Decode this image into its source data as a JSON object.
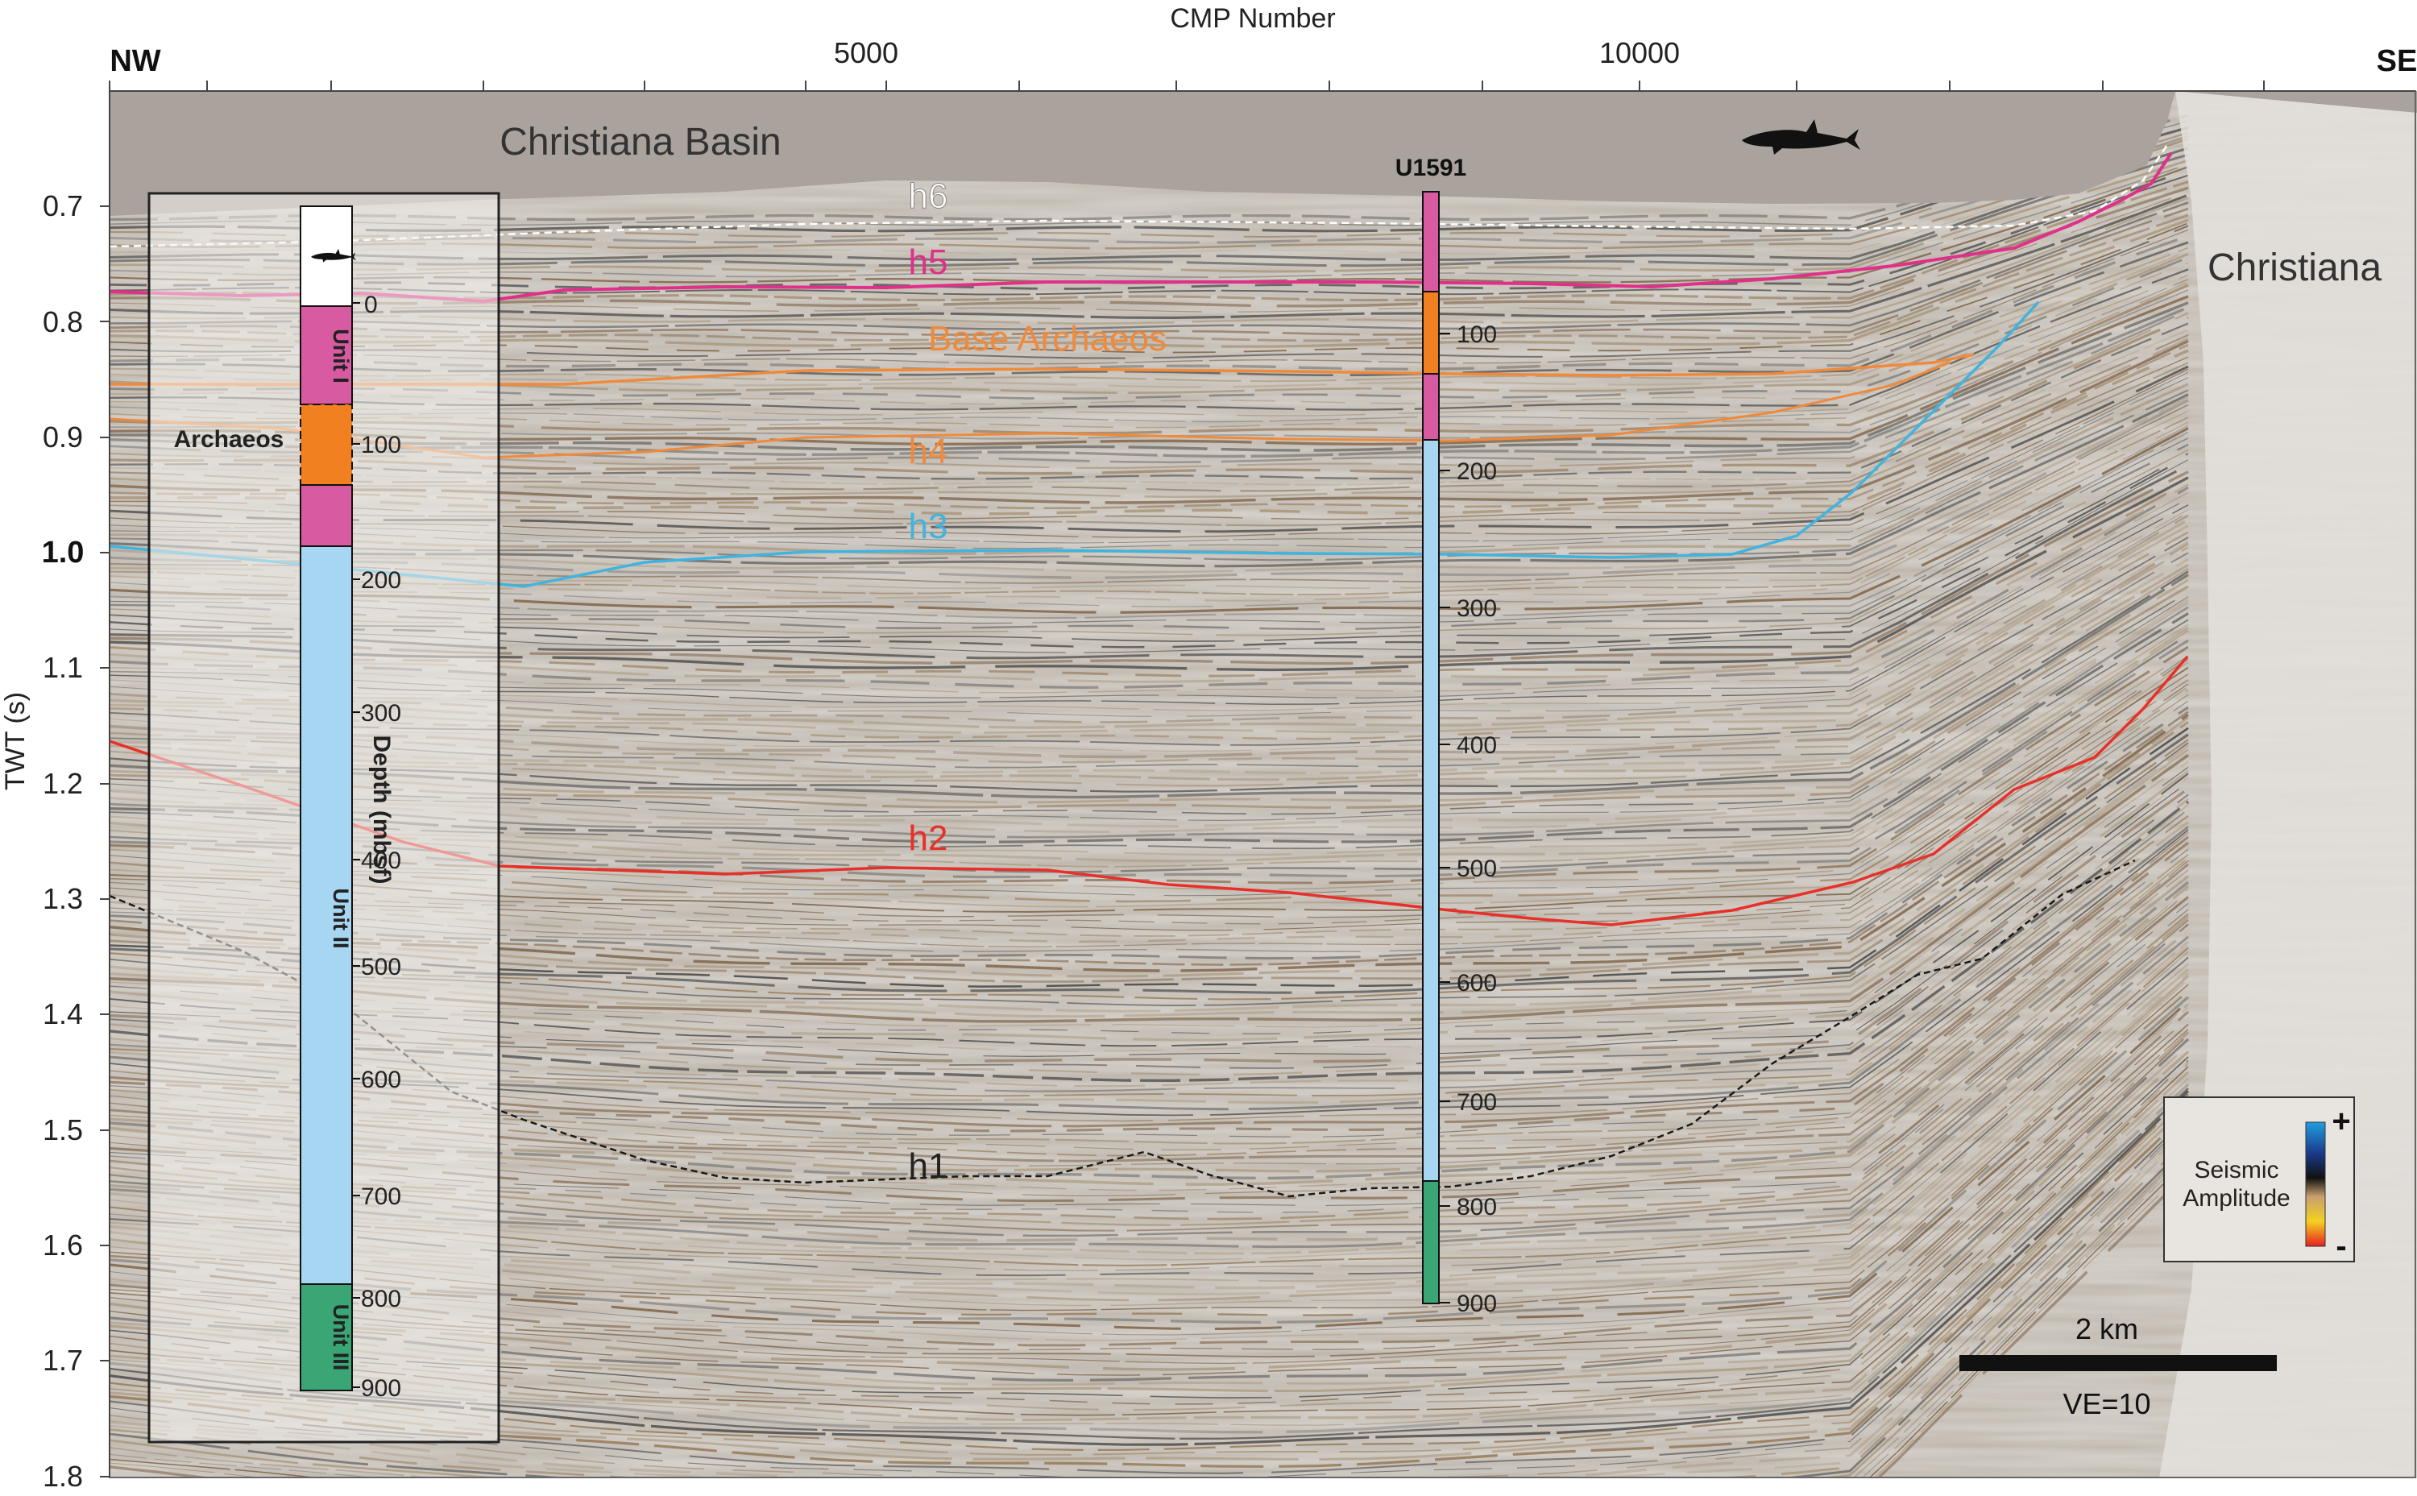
{
  "axes": {
    "top_title": "CMP Number",
    "top_ticks": [
      "5000",
      "10000"
    ],
    "left_title": "TWT (s)",
    "left_ticks": [
      "0.7",
      "0.8",
      "0.9",
      "1.0",
      "1.1",
      "1.2",
      "1.3",
      "1.4",
      "1.5",
      "1.6",
      "1.7",
      "1.8"
    ],
    "nw_label": "NW",
    "se_label": "SE"
  },
  "labels": {
    "basin": "Christiana Basin",
    "christiana": "Christiana",
    "well": "U1591",
    "archaeos": "Archaeos",
    "depth_title": "Depth (mbsf)"
  },
  "horizons": {
    "h6": "h6",
    "h5": "h5",
    "base_archaeos": "Base Archaeos",
    "h4": "h4",
    "h3": "h3",
    "h2": "h2",
    "h1": "h1"
  },
  "stratigraphic_column": {
    "units": [
      "Unit I",
      "Unit II",
      "Unit III"
    ],
    "depth_ticks": [
      "0",
      "100",
      "200",
      "300",
      "400",
      "500",
      "600",
      "700",
      "800",
      "900"
    ]
  },
  "well_column": {
    "depth_ticks": [
      "100",
      "200",
      "300",
      "400",
      "500",
      "600",
      "700",
      "800",
      "900"
    ]
  },
  "legend": {
    "title_line1": "Seismic",
    "title_line2": "Amplitude",
    "plus": "+",
    "minus": "-"
  },
  "scale_bar": {
    "label": "2 km",
    "ve": "VE=10"
  },
  "colors": {
    "unit_i": "#d85aa0",
    "archaeos": "#f08020",
    "unit_ii": "#a6d6f2",
    "unit_iii": "#3aa676",
    "h5": "#e0308a",
    "base_archaeos": "#f08a3a",
    "h3": "#40b4e0",
    "h2": "#e8302a",
    "water": "#aaa39d"
  }
}
